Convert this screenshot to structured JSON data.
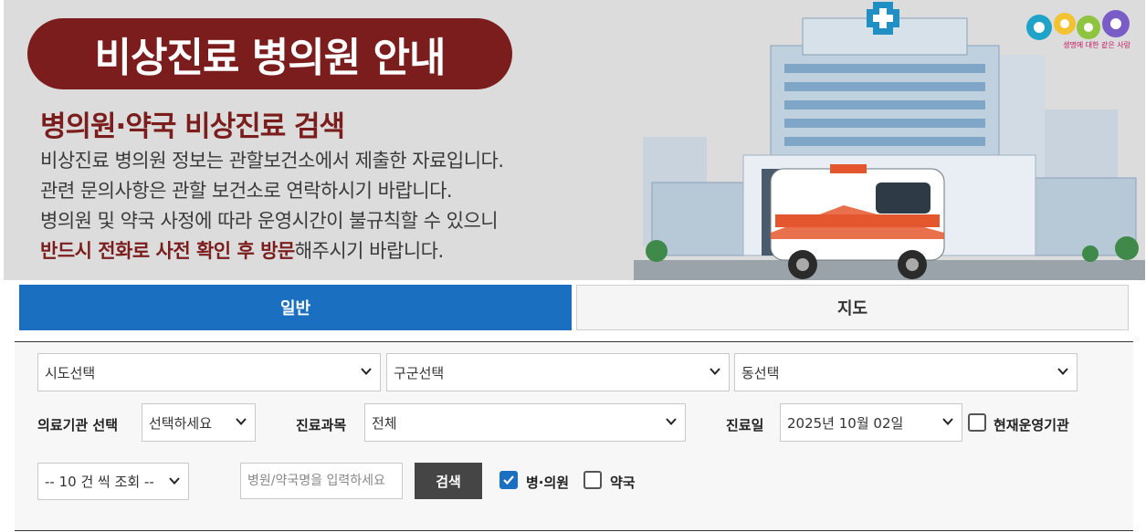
{
  "banner": {
    "title": "비상진료 병의원 안내",
    "subtitle": "병의원·약국 비상진료 검색",
    "desc_line1": "비상진료 병의원 정보는 관할보건소에서 제출한 자료입니다.",
    "desc_line2": "관련 문의사항은 관할 보건소로 연락하시기 바랍니다.",
    "desc_line3": "병의원 및 약국 사정에 따라 운영시간이 불규칙할 수 있으니",
    "desc_line4_emph": "반드시 전화로 사전 확인 후 방문",
    "desc_line4_rest": "해주시기 바랍니다.",
    "logo_tagline": "생명에 대한 같은 사랑"
  },
  "tabs": {
    "general": "일반",
    "map": "지도"
  },
  "filters": {
    "sido": "시도선택",
    "gugun": "구군선택",
    "dong": "동선택",
    "institution_label": "의료기관 선택",
    "institution_value": "선택하세요",
    "department_label": "진료과목",
    "department_value": "전체",
    "date_label": "진료일",
    "date_value": "2025년 10월 02일",
    "open_now_label": "현재운영기관",
    "page_size": "-- 10 건 씩 조회 --",
    "name_placeholder": "병원/약국명을 입력하세요",
    "search_button": "검색",
    "hospital_label": "병·의원",
    "pharmacy_label": "약국"
  },
  "colors": {
    "banner_accent": "#7b1d1d",
    "tab_active": "#1a6fc0",
    "search_button": "#454545"
  }
}
